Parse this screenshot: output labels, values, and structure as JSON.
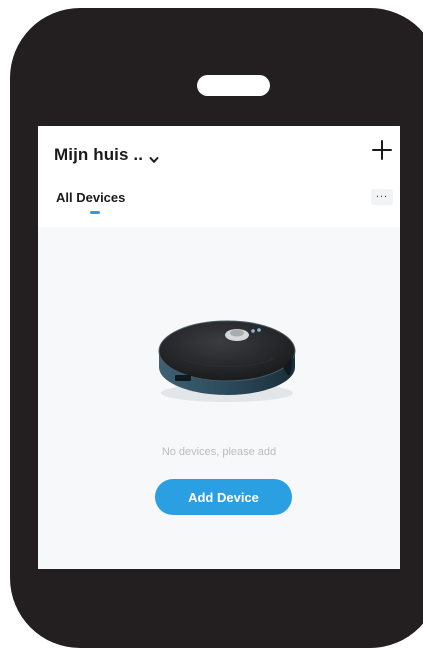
{
  "header": {
    "home_name": "Mijn huis ..",
    "chevron_icon": "chevron-down-icon",
    "add_icon": "plus-icon"
  },
  "tabs": {
    "all_devices": "All Devices",
    "more_icon": "more-icon",
    "more_glyph": "..."
  },
  "empty_state": {
    "device_image": "robot-vacuum-image",
    "message": "No devices, please add",
    "add_button": "Add Device"
  },
  "colors": {
    "phone_frame": "#231f20",
    "accent": "#2aa0e3",
    "screen_bg": "#f6f8fa",
    "empty_text": "#b9bcc1"
  }
}
